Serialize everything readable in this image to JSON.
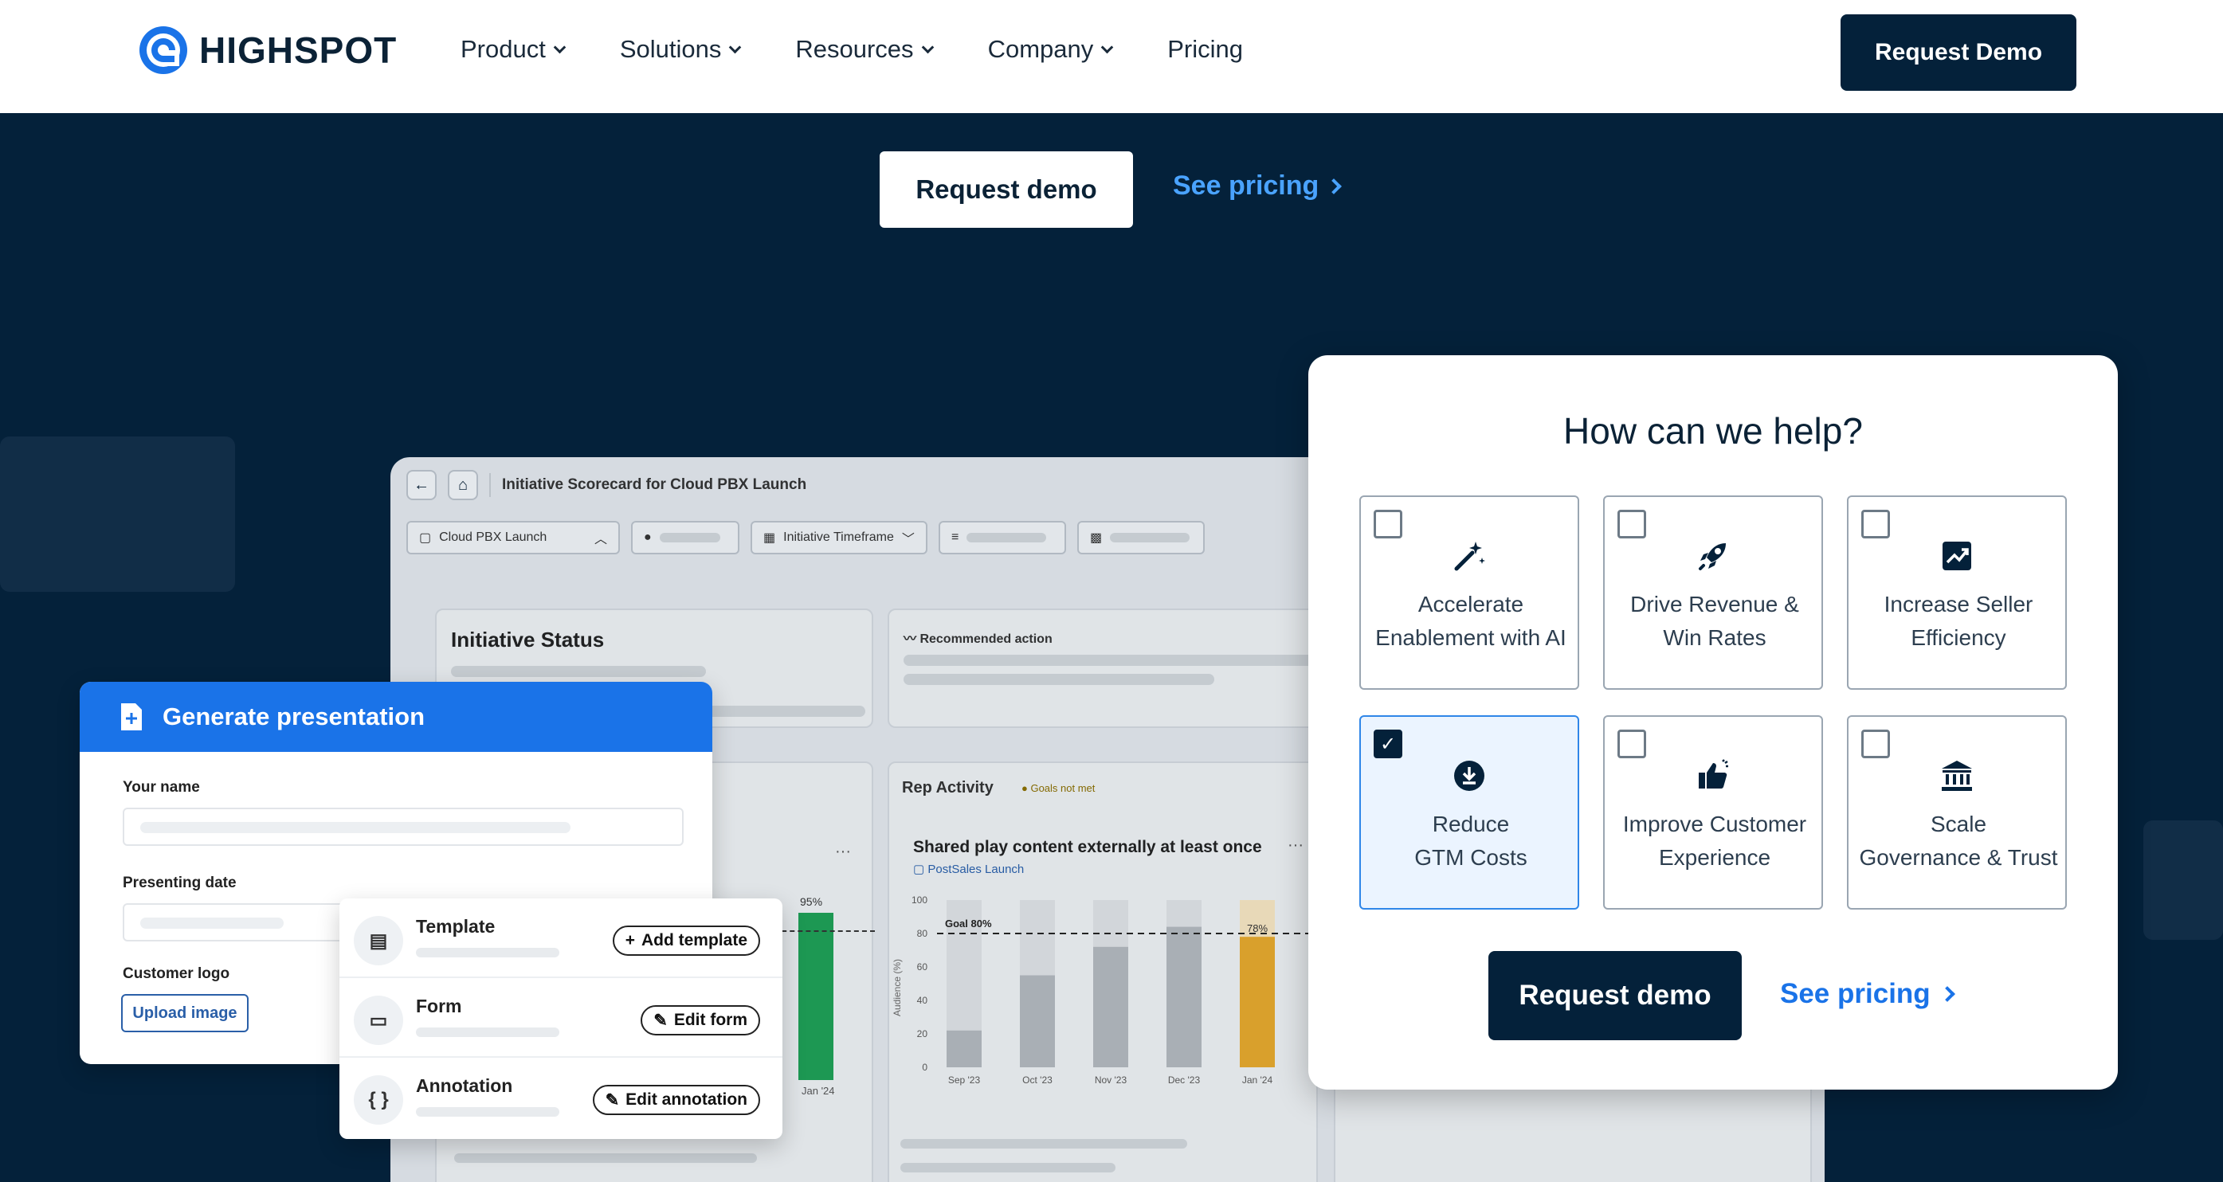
{
  "nav": {
    "logo_text": "HIGHSPOT",
    "items": [
      {
        "label": "Product",
        "has_dropdown": true
      },
      {
        "label": "Solutions",
        "has_dropdown": true
      },
      {
        "label": "Resources",
        "has_dropdown": true
      },
      {
        "label": "Company",
        "has_dropdown": true
      },
      {
        "label": "Pricing",
        "has_dropdown": false
      }
    ],
    "cta": "Request Demo"
  },
  "hero": {
    "demo_label": "Request demo",
    "pricing_label": "See pricing"
  },
  "dashboard": {
    "title": "Initiative Scorecard for Cloud PBX Launch",
    "filters": [
      "Cloud PBX Launch",
      "Initiative Timeframe"
    ],
    "initiative_status": "Initiative Status",
    "recommended_action": "Recommended action",
    "rep_activity": "Rep Activity",
    "goals_badge": "Goals not met",
    "chart_title": "Shared play content externally at least once",
    "chart_subtitle": "PostSales Launch",
    "goal_label": "Goal 80%",
    "left_bar_label": "95%",
    "left_bar_x": "Jan '24"
  },
  "chart_data": {
    "type": "bar",
    "title": "Shared play content externally at least once",
    "categories": [
      "Sep '23",
      "Oct '23",
      "Nov '23",
      "Dec '23",
      "Jan '24"
    ],
    "values": [
      22,
      55,
      72,
      84,
      78
    ],
    "highlight_label": "78%",
    "ylabel": "Audience (%)",
    "yticks": [
      0,
      20,
      40,
      60,
      80,
      100
    ],
    "ylim": [
      0,
      100
    ],
    "goal": 80
  },
  "generate": {
    "title": "Generate presentation",
    "your_name": "Your name",
    "presenting_date": "Presenting date",
    "customer_logo": "Customer logo",
    "upload": "Upload image"
  },
  "templates": [
    {
      "title": "Template",
      "action": "Add template",
      "icon": "template-icon",
      "action_icon": "+"
    },
    {
      "title": "Form",
      "action": "Edit form",
      "icon": "form-icon",
      "action_icon": "✎"
    },
    {
      "title": "Annotation",
      "action": "Edit annotation",
      "icon": "annotation-icon",
      "action_icon": "✎"
    }
  ],
  "help": {
    "title": "How can we help?",
    "options": [
      {
        "label_1": "Accelerate",
        "label_2": "Enablement with AI",
        "checked": false,
        "icon": "magic-wand-icon"
      },
      {
        "label_1": "Drive Revenue &",
        "label_2": "Win Rates",
        "checked": false,
        "icon": "rocket-icon"
      },
      {
        "label_1": "Increase Seller",
        "label_2": "Efficiency",
        "checked": false,
        "icon": "trend-up-icon"
      },
      {
        "label_1": "Reduce",
        "label_2": "GTM Costs",
        "checked": true,
        "icon": "download-circle-icon"
      },
      {
        "label_1": "Improve Customer",
        "label_2": "Experience",
        "checked": false,
        "icon": "thumbs-up-icon"
      },
      {
        "label_1": "Scale",
        "label_2": "Governance & Trust",
        "checked": false,
        "icon": "bank-icon"
      }
    ],
    "demo_label": "Request demo",
    "pricing_label": "See pricing"
  },
  "colors": {
    "navy": "#04213a",
    "blue": "#1a73e8",
    "light_blue": "#4aa3ff"
  }
}
